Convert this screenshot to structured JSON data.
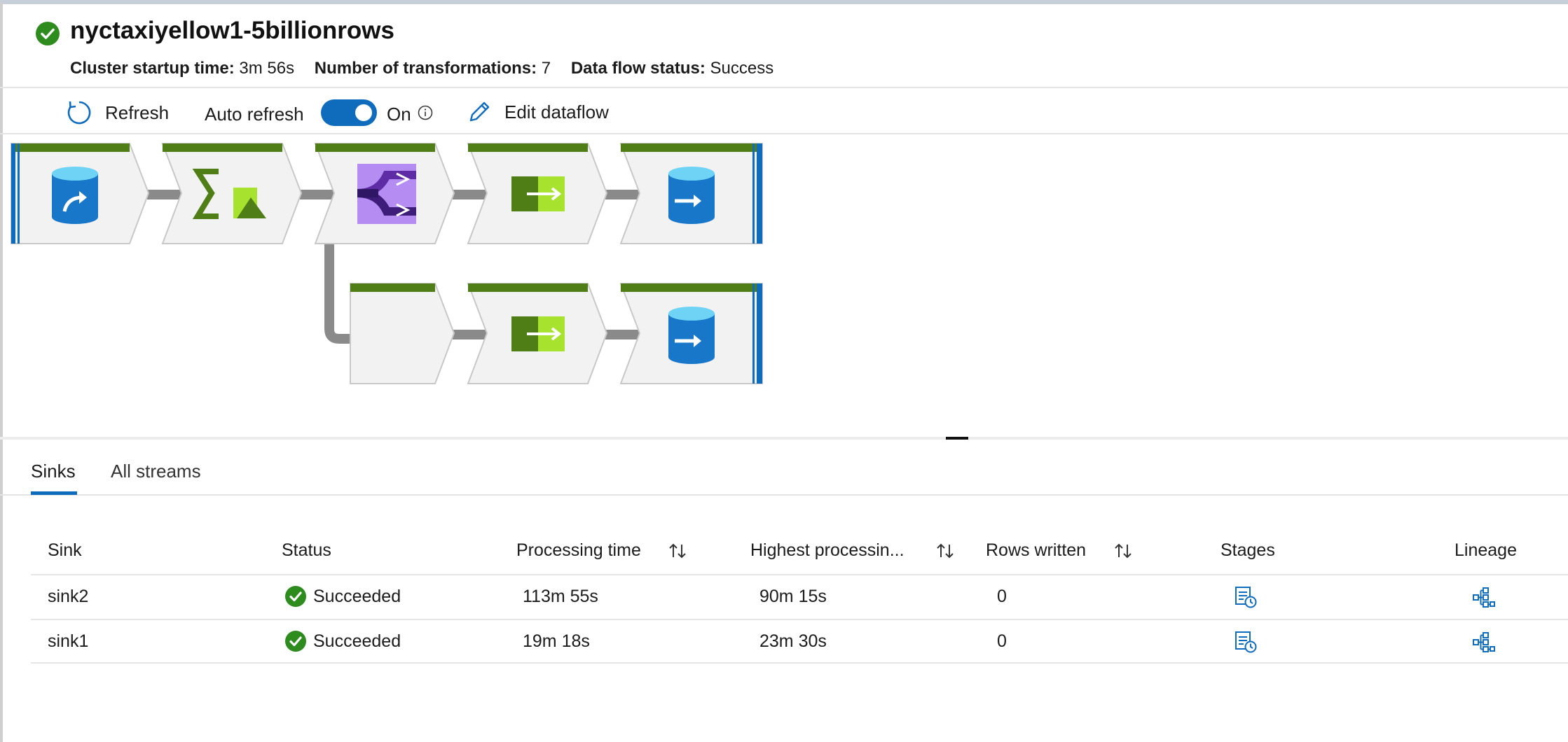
{
  "header": {
    "title": "nyctaxiyellow1-5billionrows",
    "cluster_startup_label": "Cluster startup time:",
    "cluster_startup_value": "3m 56s",
    "transformations_label": "Number of transformations:",
    "transformations_value": "7",
    "status_label": "Data flow status:",
    "status_value": "Success"
  },
  "toolbar": {
    "refresh_label": "Refresh",
    "auto_refresh_label": "Auto refresh",
    "auto_refresh_on": true,
    "toggle_state_label": "On",
    "edit_label": "Edit dataflow"
  },
  "flow": {
    "accent_color": "#4f7d16",
    "stream_row1": [
      "source",
      "aggregate",
      "conditional-split",
      "select",
      "sink"
    ],
    "stream_row2": [
      "empty",
      "select",
      "sink"
    ]
  },
  "tabs": [
    {
      "label": "Sinks",
      "active": true
    },
    {
      "label": "All streams",
      "active": false
    }
  ],
  "table": {
    "columns": {
      "sink": "Sink",
      "status": "Status",
      "processing_time": "Processing time",
      "highest_processing": "Highest processin...",
      "rows_written": "Rows written",
      "stages": "Stages",
      "lineage": "Lineage"
    },
    "rows": [
      {
        "sink": "sink2",
        "status": "Succeeded",
        "processing_time": "113m 55s",
        "highest_processing": "90m 15s",
        "rows_written": "0"
      },
      {
        "sink": "sink1",
        "status": "Succeeded",
        "processing_time": "19m 18s",
        "highest_processing": "23m 30s",
        "rows_written": "0"
      }
    ]
  },
  "colors": {
    "accent_blue": "#0f6cbd",
    "success_green": "#2e8b1e",
    "node_header_green": "#4f7d16"
  }
}
